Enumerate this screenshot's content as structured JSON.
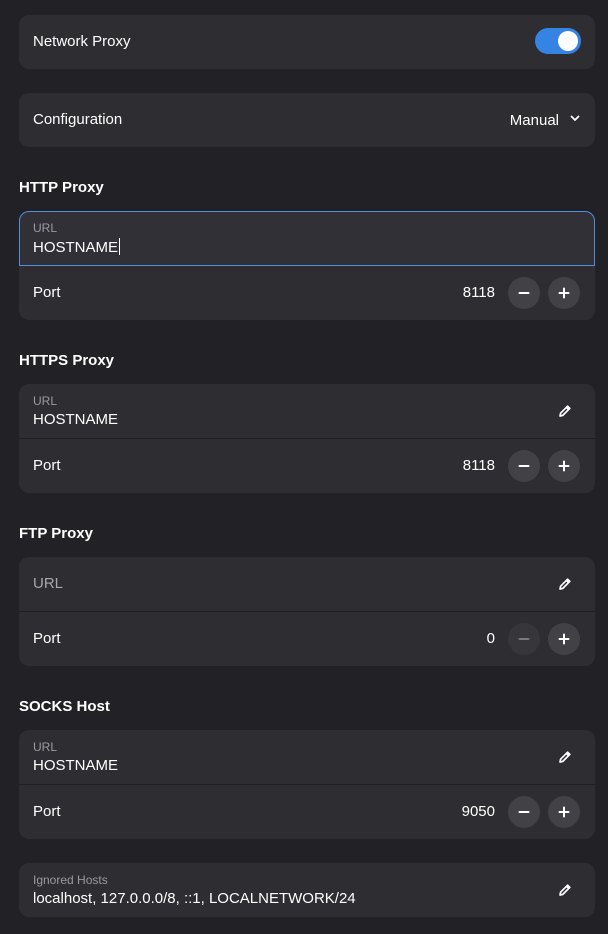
{
  "network_proxy": {
    "label": "Network Proxy",
    "enabled": true
  },
  "configuration": {
    "label": "Configuration",
    "value": "Manual"
  },
  "http": {
    "title": "HTTP Proxy",
    "url_caption": "URL",
    "url_value": "HOSTNAME",
    "port_label": "Port",
    "port_value": "8118"
  },
  "https": {
    "title": "HTTPS Proxy",
    "url_caption": "URL",
    "url_value": "HOSTNAME",
    "port_label": "Port",
    "port_value": "8118"
  },
  "ftp": {
    "title": "FTP Proxy",
    "url_placeholder": "URL",
    "port_label": "Port",
    "port_value": "0"
  },
  "socks": {
    "title": "SOCKS Host",
    "url_caption": "URL",
    "url_value": "HOSTNAME",
    "port_label": "Port",
    "port_value": "9050"
  },
  "ignored": {
    "caption": "Ignored Hosts",
    "value": "localhost, 127.0.0.0/8, ::1, LOCALNETWORK/24"
  },
  "icons": {
    "edit": "pencil-icon",
    "decrement": "minus-icon",
    "increment": "plus-icon",
    "dropdown": "chevron-down-icon"
  },
  "colors": {
    "accent": "#3584e4",
    "focus_border": "#4f8ee0"
  }
}
